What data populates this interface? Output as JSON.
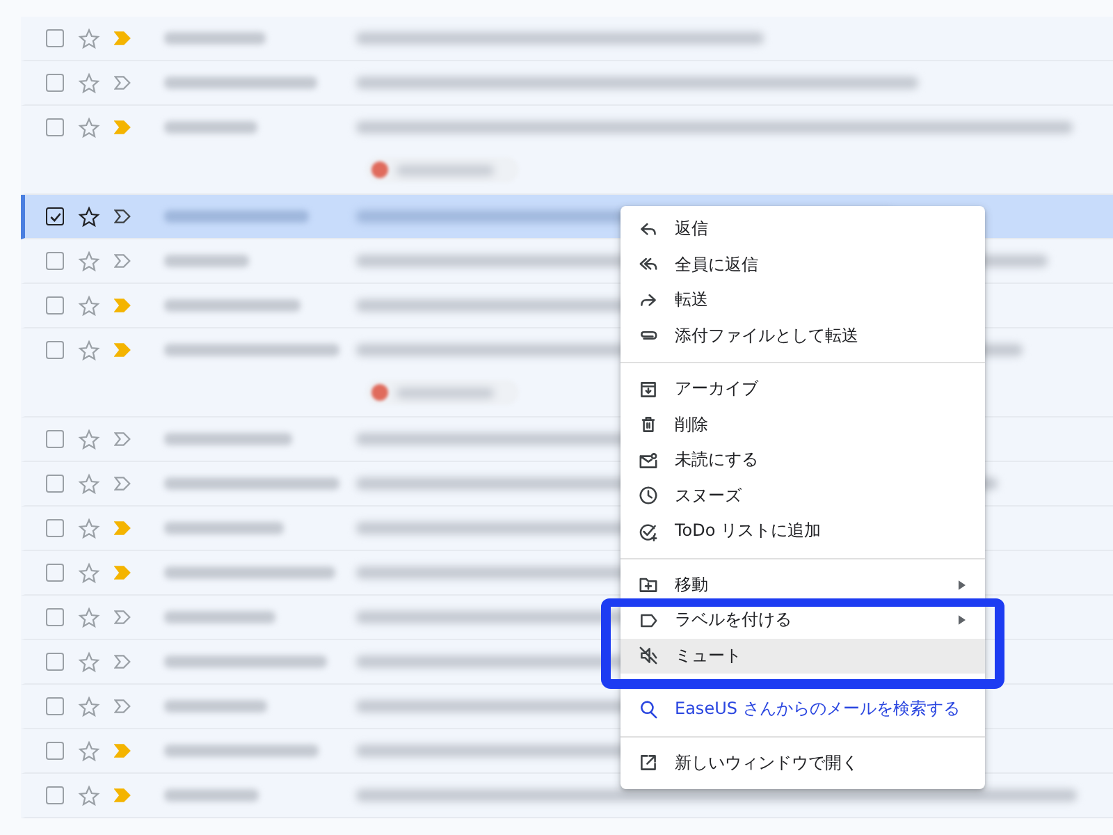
{
  "rows": [
    {
      "selected": false,
      "checked": false,
      "important": true,
      "attachment": false
    },
    {
      "selected": false,
      "checked": false,
      "important": false,
      "attachment": false
    },
    {
      "selected": false,
      "checked": false,
      "important": true,
      "attachment": true
    },
    {
      "selected": true,
      "checked": true,
      "important": false,
      "attachment": false
    },
    {
      "selected": false,
      "checked": false,
      "important": false,
      "attachment": false
    },
    {
      "selected": false,
      "checked": false,
      "important": true,
      "attachment": false
    },
    {
      "selected": false,
      "checked": false,
      "important": true,
      "attachment": true
    },
    {
      "selected": false,
      "checked": false,
      "important": false,
      "attachment": false
    },
    {
      "selected": false,
      "checked": false,
      "important": false,
      "attachment": false
    },
    {
      "selected": false,
      "checked": false,
      "important": true,
      "attachment": false
    },
    {
      "selected": false,
      "checked": false,
      "important": true,
      "attachment": false
    },
    {
      "selected": false,
      "checked": false,
      "important": false,
      "attachment": false
    },
    {
      "selected": false,
      "checked": false,
      "important": false,
      "attachment": false
    },
    {
      "selected": false,
      "checked": false,
      "important": false,
      "attachment": false
    },
    {
      "selected": false,
      "checked": false,
      "important": true,
      "attachment": false
    },
    {
      "selected": false,
      "checked": false,
      "important": true,
      "attachment": false
    }
  ],
  "context_menu": {
    "groups": [
      {
        "items": [
          {
            "kind": "action",
            "label": "返信",
            "highlighted": false,
            "submenu": false
          },
          {
            "kind": "action",
            "label": "全員に返信",
            "highlighted": false,
            "submenu": false
          },
          {
            "kind": "action",
            "label": "転送",
            "highlighted": false,
            "submenu": false
          },
          {
            "kind": "action",
            "label": "添付ファイルとして転送",
            "highlighted": false,
            "submenu": false
          }
        ]
      },
      {
        "items": [
          {
            "kind": "action",
            "label": "アーカイブ",
            "highlighted": false,
            "submenu": false
          },
          {
            "kind": "action",
            "label": "削除",
            "highlighted": false,
            "submenu": false
          },
          {
            "kind": "action",
            "label": "未読にする",
            "highlighted": false,
            "submenu": false
          },
          {
            "kind": "action",
            "label": "スヌーズ",
            "highlighted": false,
            "submenu": false
          },
          {
            "kind": "action",
            "label": "ToDo リストに追加",
            "highlighted": false,
            "submenu": false
          }
        ]
      },
      {
        "items": [
          {
            "kind": "action",
            "label": "移動",
            "highlighted": false,
            "submenu": true
          },
          {
            "kind": "action",
            "label": "ラベルを付ける",
            "highlighted": false,
            "submenu": true
          },
          {
            "kind": "action",
            "label": "ミュート",
            "highlighted": true,
            "submenu": false
          }
        ]
      },
      {
        "items": [
          {
            "kind": "search",
            "label": "EaseUS さんからのメールを検索する",
            "highlighted": false,
            "submenu": false
          }
        ]
      },
      {
        "items": [
          {
            "kind": "action",
            "label": "新しいウィンドウで開く",
            "highlighted": false,
            "submenu": false
          }
        ]
      }
    ]
  }
}
